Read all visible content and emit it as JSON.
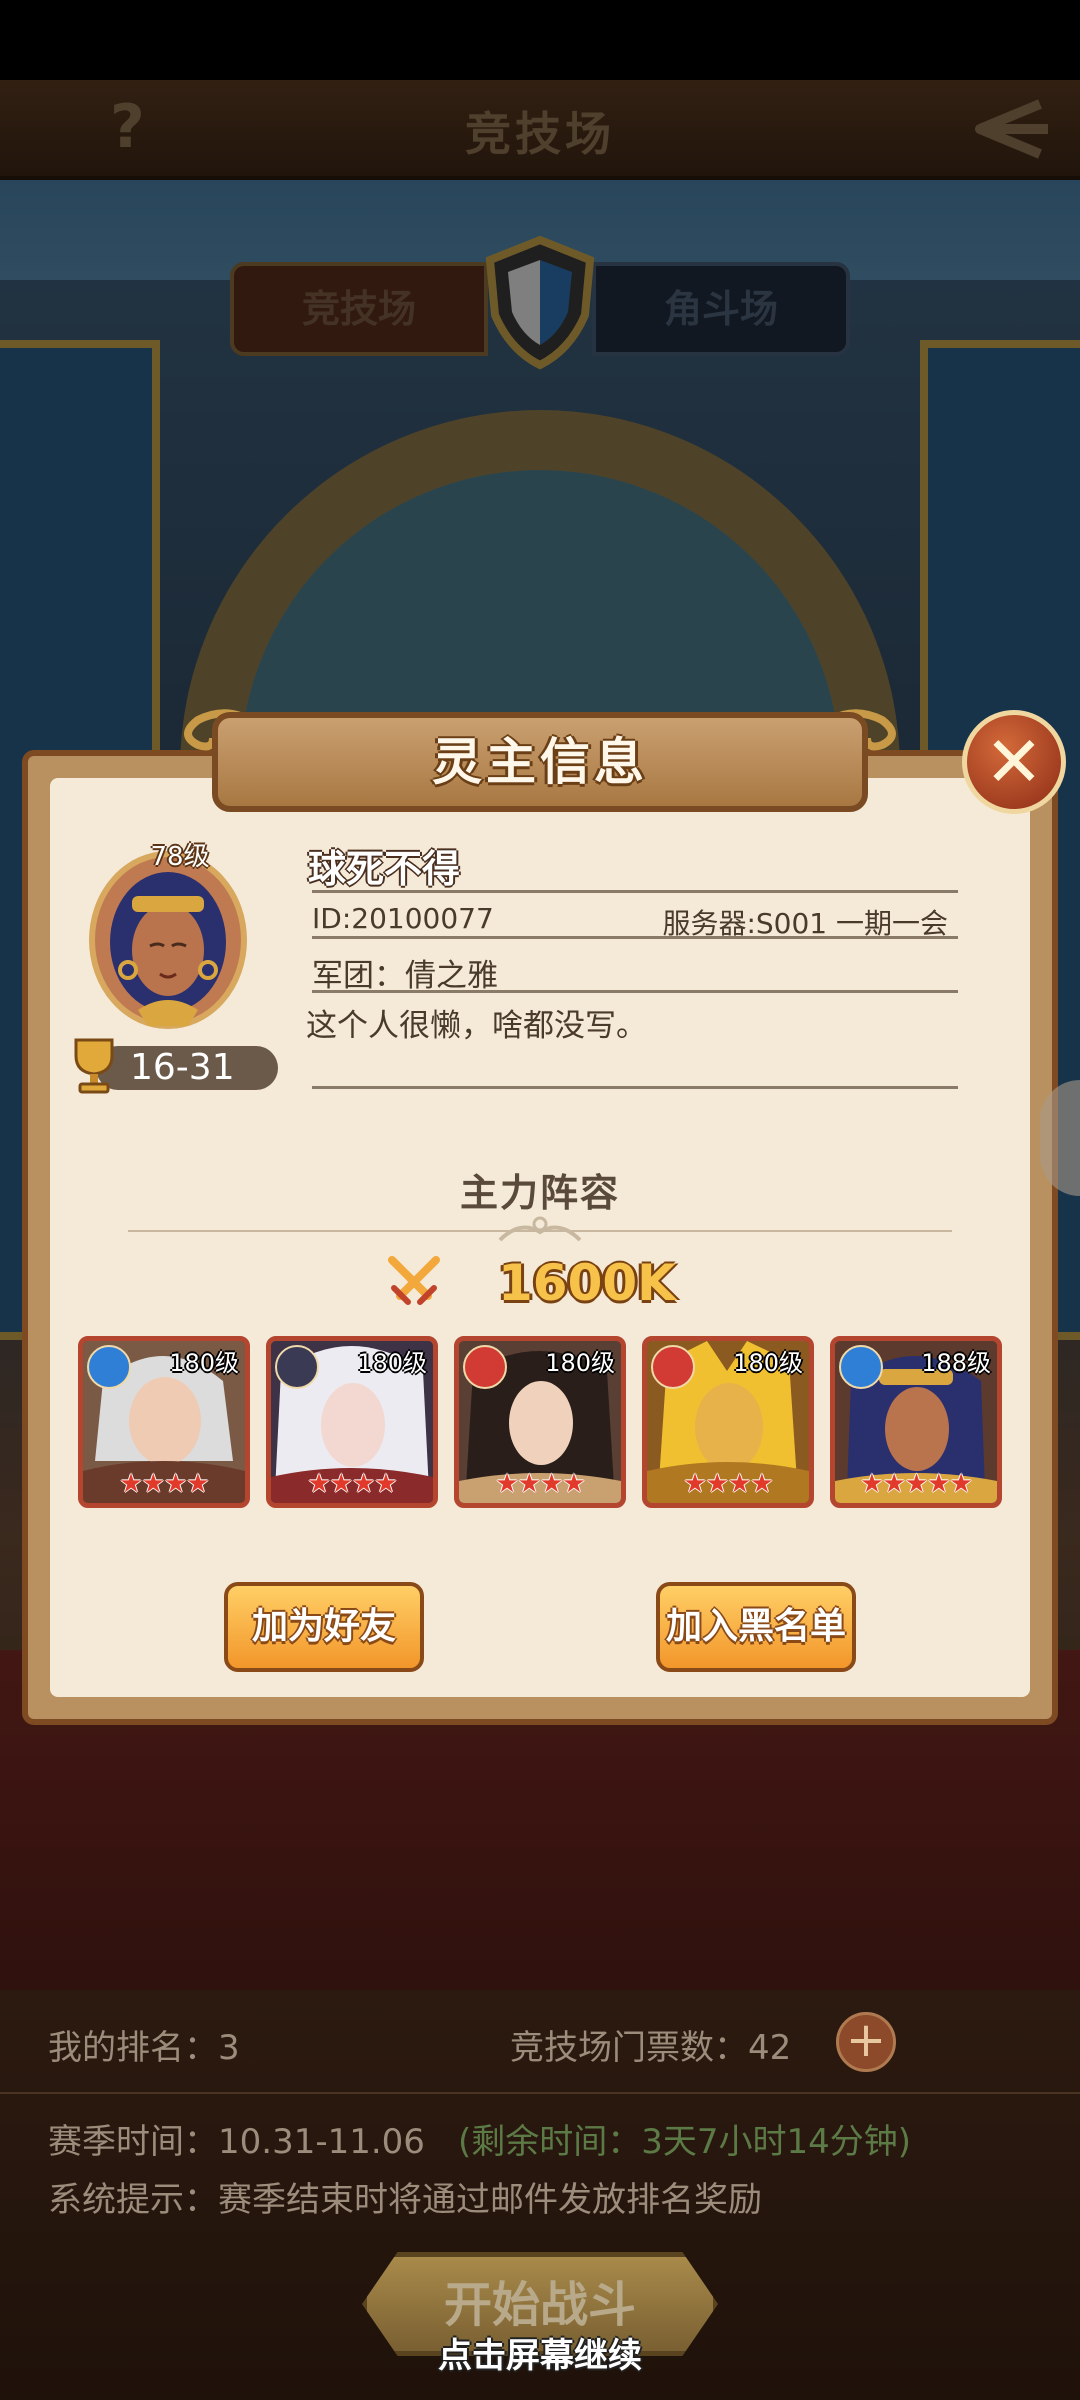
{
  "header": {
    "help_icon": "question-mark-icon",
    "title": "竞技场",
    "back_icon": "back-arrow-icon"
  },
  "tabs": [
    {
      "label": "竞技场"
    },
    {
      "label": "角斗场"
    }
  ],
  "modal": {
    "title": "灵主信息",
    "close_icon": "close-icon",
    "player": {
      "level": "78级",
      "name": "球死不得",
      "id": "ID:20100077",
      "server": "服务器:S001 一期一会",
      "guild": "军团：倩之雅",
      "signature": "这个人很懒，啥都没写。",
      "rank": "16-31"
    },
    "lineup_title": "主力阵容",
    "power": "1600K",
    "heroes": [
      {
        "level": "180级",
        "element": "water",
        "element_color": "#2f7fd6",
        "stars": 4,
        "stars_text": "★★★★"
      },
      {
        "level": "180级",
        "element": "dark",
        "element_color": "#3a3a55",
        "stars": 4,
        "stars_text": "★★★★"
      },
      {
        "level": "180级",
        "element": "fire",
        "element_color": "#d23a34",
        "stars": 4,
        "stars_text": "★★★★"
      },
      {
        "level": "180级",
        "element": "fire",
        "element_color": "#d23a34",
        "stars": 4,
        "stars_text": "★★★★"
      },
      {
        "level": "188级",
        "element": "water",
        "element_color": "#2f7fd6",
        "stars": 5,
        "stars_text": "★★★★★"
      }
    ],
    "add_friend_label": "加为好友",
    "blacklist_label": "加入黑名单"
  },
  "bottom": {
    "my_rank": "我的排名：3",
    "tickets": "竞技场门票数：42",
    "season": "赛季时间：10.31-11.06",
    "remaining": "(剩余时间：3天7小时14分钟)",
    "tip": "系统提示：赛季结束时将通过邮件发放排名奖励",
    "start_label": "开始战斗",
    "tap_hint": "点击屏幕继续"
  },
  "colors": {
    "accent_gold": "#f6c24a",
    "button_orange": "#f2962a",
    "modal_bg": "#f5ead8"
  }
}
